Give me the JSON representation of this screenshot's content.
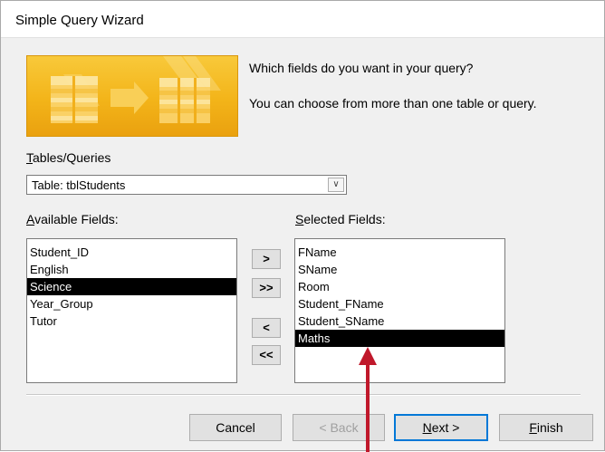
{
  "window": {
    "title": "Simple Query Wizard"
  },
  "prompt": {
    "line1": "Which fields do you want in your query?",
    "line2": "You can choose from more than one table or query."
  },
  "tables": {
    "label_accel": "T",
    "label_rest": "ables/Queries",
    "selected": "Table: tblStudents",
    "dropdown_glyph": "∨"
  },
  "available": {
    "label_accel": "A",
    "label_rest": "vailable Fields:",
    "items": [
      "Student_ID",
      "English",
      "Science",
      "Year_Group",
      "Tutor"
    ],
    "selected_index": 2
  },
  "selected_fields": {
    "label_accel": "S",
    "label_rest": "elected Fields:",
    "items": [
      "FName",
      "SName",
      "Room",
      "Student_FName",
      "Student_SName",
      "Maths"
    ],
    "selected_index": 5
  },
  "move_buttons": {
    "add_one": ">",
    "add_all": ">>",
    "remove_one": "<",
    "remove_all": "<<"
  },
  "buttons": {
    "cancel": "Cancel",
    "back": "< Back",
    "next_accel": "N",
    "next_rest": "ext >",
    "finish_accel": "F",
    "finish_rest": "inish"
  },
  "colors": {
    "annotation_arrow": "#c0182b",
    "banner_orange": "#f3b419",
    "selection_bg": "#000000",
    "default_button_border": "#0078d7"
  }
}
